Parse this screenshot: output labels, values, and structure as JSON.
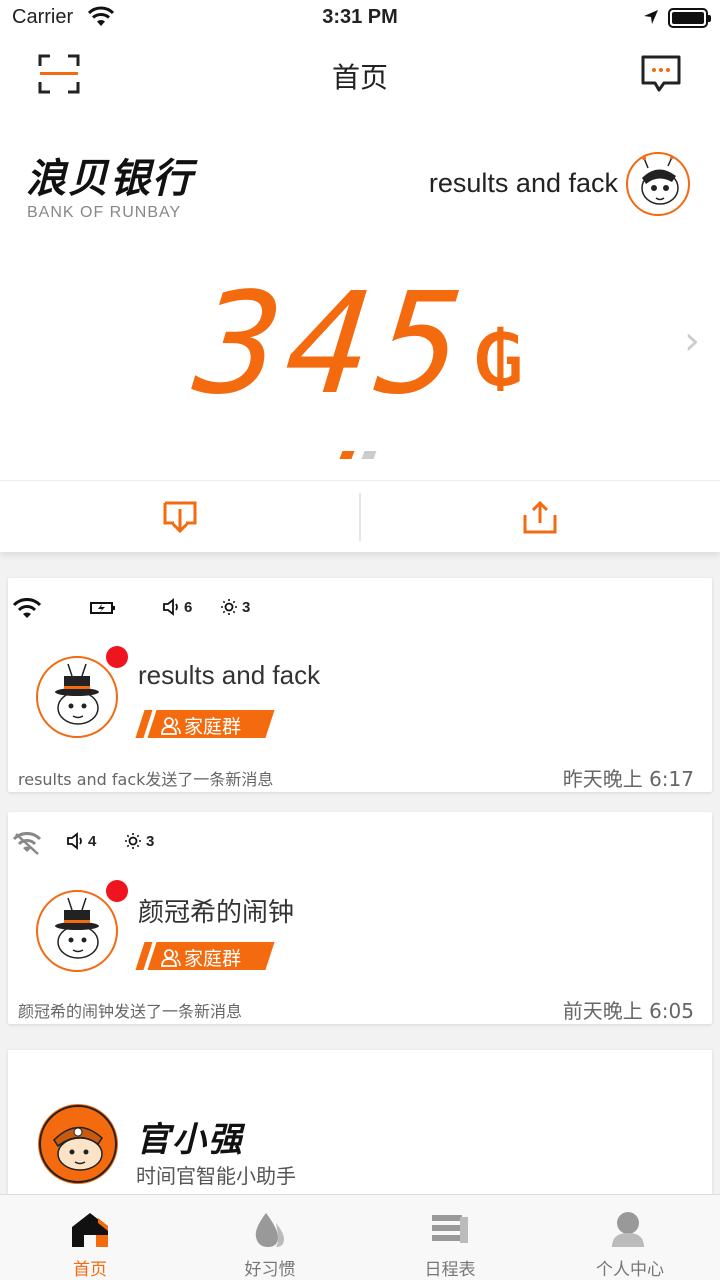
{
  "status_bar": {
    "carrier": "Carrier",
    "time": "3:31 PM"
  },
  "nav": {
    "title": "首页",
    "left_icon": "scan-icon",
    "right_icon": "message-icon"
  },
  "account": {
    "bank_name": "浪贝银行",
    "bank_subtitle": "BANK OF RUNBAY",
    "user_name": "results and fack",
    "balance": "345",
    "currency_symbol": "₲"
  },
  "actions": {
    "left_icon": "download-icon",
    "right_icon": "upload-icon"
  },
  "devices": [
    {
      "name": "results and fack",
      "wifi": "connected",
      "volume": "6",
      "brightness": "3",
      "tag": "家庭群",
      "message": "results and fack发送了一条新消息",
      "time": "昨天晚上 6:17"
    },
    {
      "name": "颜冠希的闹钟",
      "wifi": "disconnected",
      "volume": "4",
      "brightness": "3",
      "tag": "家庭群",
      "message": "颜冠希的闹钟发送了一条新消息",
      "time": "前天晚上 6:05"
    }
  ],
  "assistant": {
    "name": "官小强",
    "subtitle": "时间官智能小助手"
  },
  "tabs": [
    {
      "label": "首页",
      "icon": "home-icon",
      "active": true
    },
    {
      "label": "好习惯",
      "icon": "drop-icon",
      "active": false
    },
    {
      "label": "日程表",
      "icon": "schedule-icon",
      "active": false
    },
    {
      "label": "个人中心",
      "icon": "person-icon",
      "active": false
    }
  ],
  "colors": {
    "accent": "#f46a0f",
    "badge": "#f0141e"
  }
}
